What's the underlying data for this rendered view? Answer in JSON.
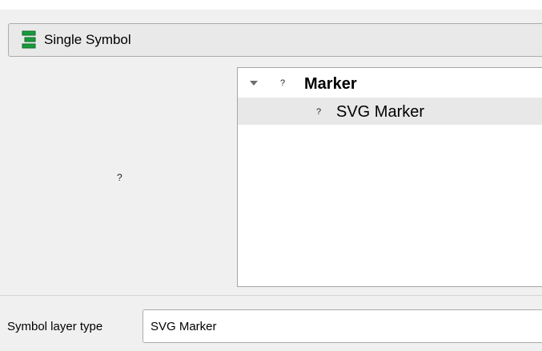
{
  "renderer": {
    "label": "Single Symbol",
    "icon": "single-symbol-icon",
    "icon_color": "#1a9b3b"
  },
  "preview": {
    "placeholder": "?"
  },
  "symbol_tree": {
    "items": [
      {
        "icon": "?",
        "label": "Marker",
        "expanded": true
      },
      {
        "icon": "?",
        "label": "SVG Marker",
        "selected": true
      }
    ]
  },
  "symbol_layer_type": {
    "label": "Symbol layer type",
    "value": "SVG Marker"
  }
}
